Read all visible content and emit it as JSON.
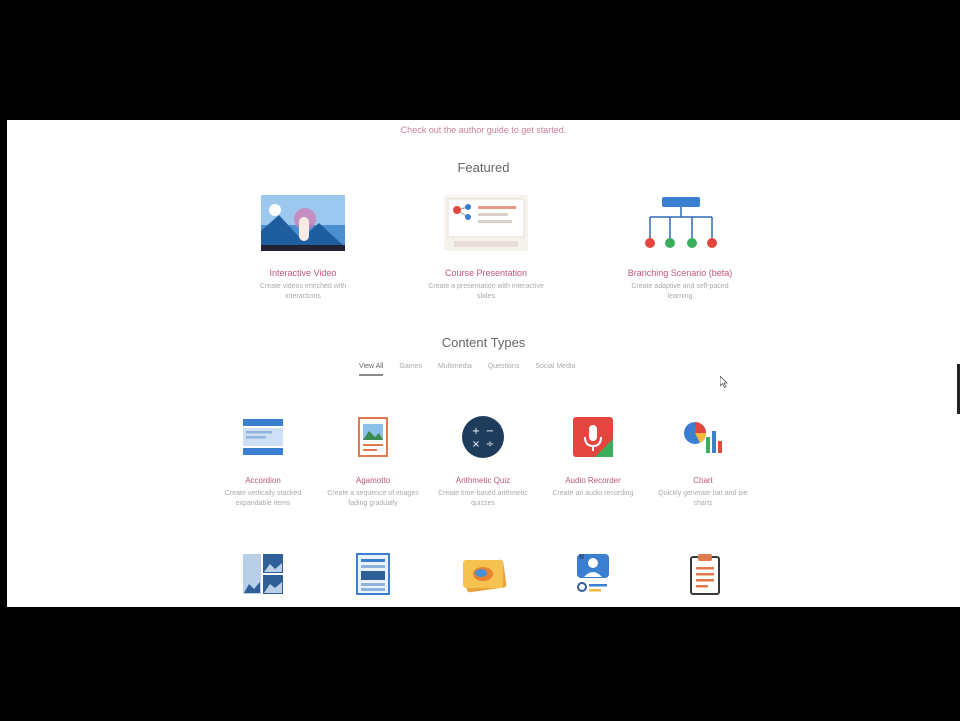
{
  "tagline": "Check out the author guide to get started.",
  "featured": {
    "title": "Featured",
    "items": [
      {
        "title": "Interactive Video",
        "desc": "Create videos enriched with interactions"
      },
      {
        "title": "Course Presentation",
        "desc": "Create a presentation with interactive slides"
      },
      {
        "title": "Branching Scenario (beta)",
        "desc": "Create adaptive and self-paced learning"
      }
    ]
  },
  "content_types": {
    "title": "Content Types",
    "tabs": [
      "View All",
      "Games",
      "Multimedia",
      "Questions",
      "Social Media"
    ],
    "active_tab": "View All",
    "items": [
      {
        "title": "Accordion",
        "desc": "Create vertically stacked expandable items"
      },
      {
        "title": "Agamotto",
        "desc": "Create a sequence of images fading gradually"
      },
      {
        "title": "Arithmetic Quiz",
        "desc": "Create time-based arithmetic quizzes"
      },
      {
        "title": "Audio Recorder",
        "desc": "Create an audio recording"
      },
      {
        "title": "Chart",
        "desc": "Quickly generate bar and pie charts"
      }
    ]
  }
}
